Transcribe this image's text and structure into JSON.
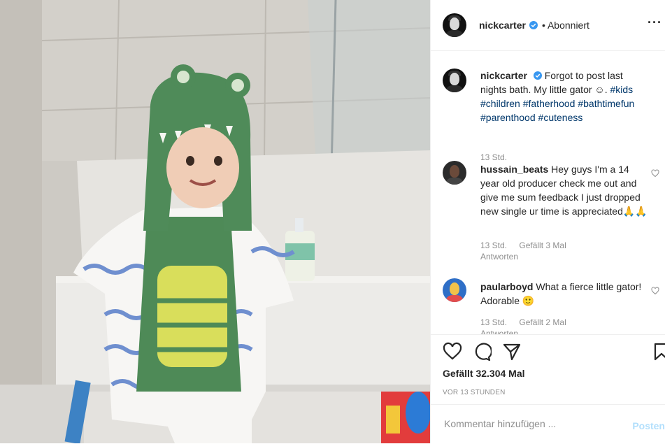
{
  "post": {
    "author": "nickcarter",
    "follow_status": "• Abonniert",
    "more_icon": "more-horizontal-icon",
    "verified_color": "#3897f0"
  },
  "caption": {
    "username": "nickcarter",
    "text_prefix": "Forgot to post last nights bath. My little gator ☺. ",
    "hashtags": [
      "#kids",
      "#children",
      "#fatherhood",
      "#bathtimefun",
      "#parenthood",
      "#cuteness"
    ],
    "time": "13 Std."
  },
  "comments": [
    {
      "username": "hussain_beats",
      "text": "Hey guys I'm a 14 year old producer check me out and give me sum feedback I just dropped new single ur time is appreciated🙏🙏",
      "time": "13 Std.",
      "likes": "Gefällt 3 Mal",
      "reply": "Antworten"
    },
    {
      "username": "paularboyd",
      "text": "What a fierce little gator! Adorable 🙂",
      "time": "13 Std.",
      "likes": "Gefällt 2 Mal",
      "reply": "Antworten"
    }
  ],
  "engagement": {
    "likes_text": "Gefällt 32.304 Mal",
    "timestamp": "VOR 13 STUNDEN"
  },
  "comment_box": {
    "placeholder": "Kommentar hinzufügen ...",
    "post_label": "Posten"
  },
  "colors": {
    "link": "#00376b",
    "muted": "#8e8e8e",
    "post_button": "#b2dffc"
  }
}
